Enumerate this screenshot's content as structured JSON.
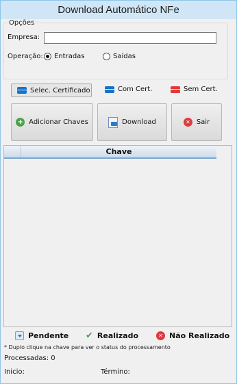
{
  "window": {
    "title": "Download Automático NFe"
  },
  "options": {
    "legend": "Opções",
    "empresa_label": "Empresa:",
    "empresa_value": "",
    "operacao_label": "Operação:",
    "radio_entradas": "Entradas",
    "radio_saidas": "Saídas",
    "selected": "Entradas"
  },
  "cert": {
    "select_button": "Selec. Certificado",
    "with_cert": "Com Cert.",
    "without_cert": "Sem Cert."
  },
  "actions": {
    "add_keys": "Adicionar Chaves",
    "download": "Download",
    "exit": "Sair"
  },
  "grid": {
    "column_header": "Chave",
    "rows": []
  },
  "status_legend": {
    "pending": "Pendente",
    "done": "Realizado",
    "not_done": "Não Realizado"
  },
  "footer": {
    "note": "* Duplo clique na chave para ver o status do processamento",
    "processed": "Processadas: 0",
    "start": "Inicio:",
    "end": "Término:"
  },
  "colors": {
    "titlebar": "#d0e6f6",
    "blue_flag": "#1773c9",
    "red_flag": "#e23a3a",
    "grid_header_accent": "#7aa6d4"
  }
}
